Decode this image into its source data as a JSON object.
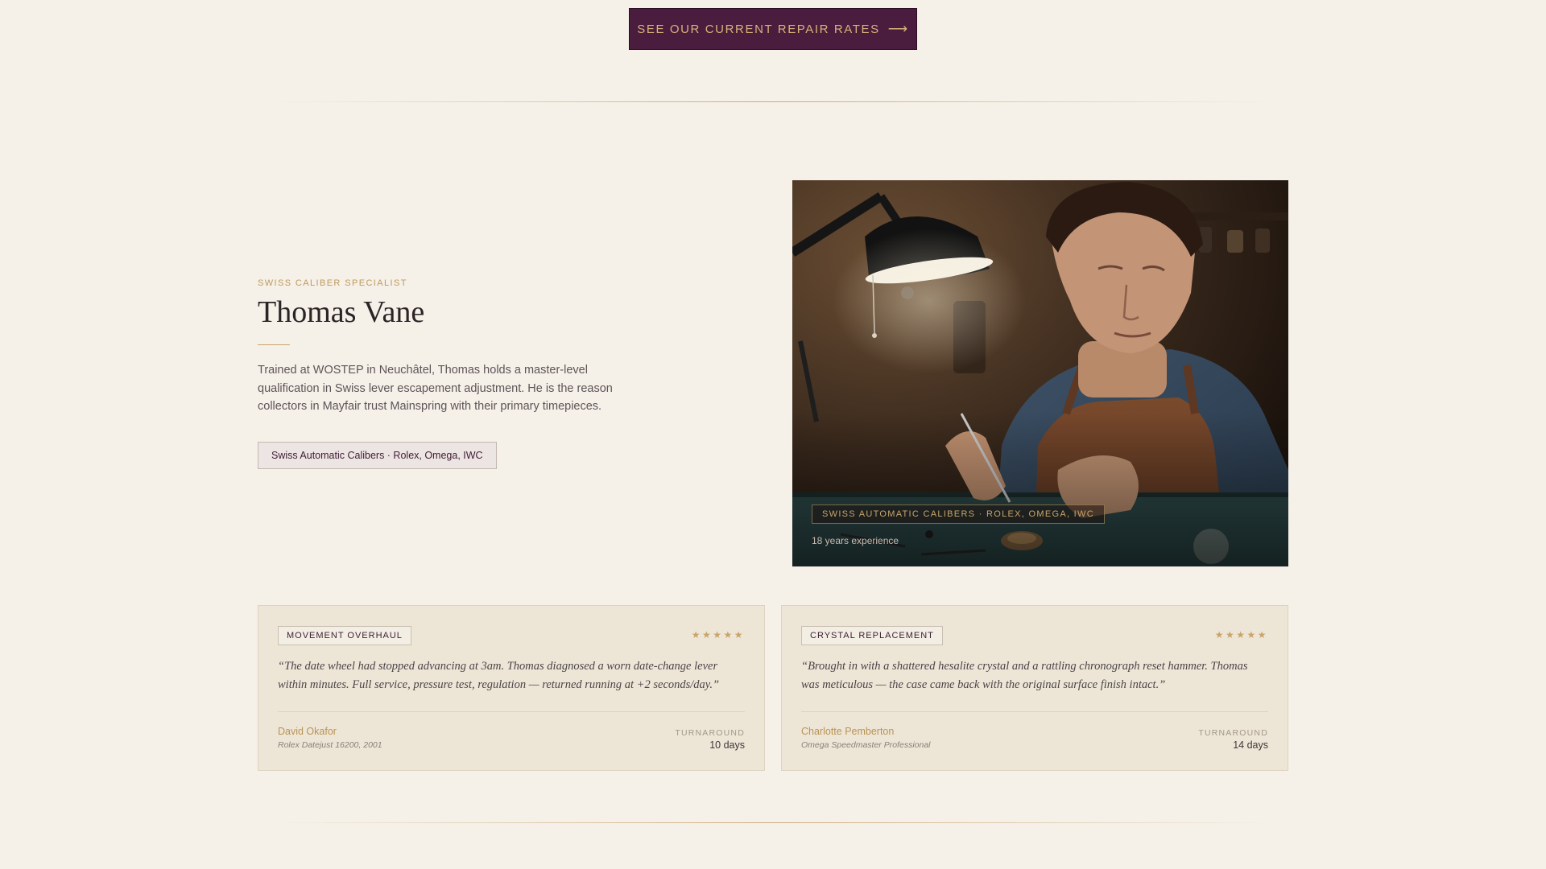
{
  "cta": {
    "label": "SEE OUR CURRENT REPAIR RATES",
    "arrow": "⟶"
  },
  "profile": {
    "eyebrow": "SWISS CALIBER SPECIALIST",
    "name": "Thomas Vane",
    "bio": "Trained at WOSTEP in Neuchâtel, Thomas holds a master-level qualification in Swiss lever escapement adjustment. He is the reason collectors in Mayfair trust Mainspring with their primary timepieces.",
    "specialty_tag": "Swiss Automatic Calibers · Rolex, Omega, IWC",
    "photo": {
      "subject": "watchmaker working under desk lamp",
      "overlay_tag": "SWISS AUTOMATIC CALIBERS · ROLEX, OMEGA, IWC",
      "experience": "18 years experience"
    }
  },
  "reviews": [
    {
      "service": "MOVEMENT OVERHAUL",
      "rating": 5,
      "stars": "★★★★★",
      "quote": "“The date wheel had stopped advancing at 3am. Thomas diagnosed a worn date-change lever within minutes. Full service, pressure test, regulation — returned running at +2 seconds/day.”",
      "client": "David Okafor",
      "watch": "Rolex Datejust 16200, 2001",
      "turnaround_label": "TURNAROUND",
      "turnaround": "10 days"
    },
    {
      "service": "CRYSTAL REPLACEMENT",
      "rating": 5,
      "stars": "★★★★★",
      "quote": "“Brought in with a shattered hesalite crystal and a rattling chronograph reset hammer. Thomas was meticulous — the case came back with the original surface finish intact.”",
      "client": "Charlotte Pemberton",
      "watch": "Omega Speedmaster Professional",
      "turnaround_label": "TURNAROUND",
      "turnaround": "14 days"
    }
  ],
  "colors": {
    "background": "#f5f0e8",
    "plum": "#4a1c3e",
    "gold": "#c9a46a",
    "card": "#ede6d7"
  }
}
